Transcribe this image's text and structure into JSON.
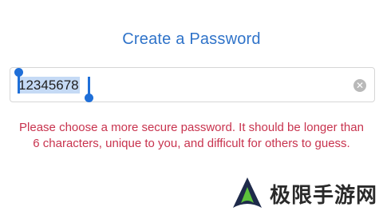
{
  "screen": {
    "title": "Create a Password"
  },
  "password_field": {
    "value": "12345678",
    "clear_icon": "clear-circle-icon"
  },
  "error_message": "Please choose a more secure password. It should be longer than 6 characters, unique to you, and difficult for others to guess.",
  "watermark": {
    "text": "极限手游网",
    "logo_icon": "triangle-logo-icon"
  },
  "colors": {
    "title": "#2f73c9",
    "error": "#c8334e",
    "selection": "#c5daf5",
    "handle": "#1f6fd8"
  }
}
